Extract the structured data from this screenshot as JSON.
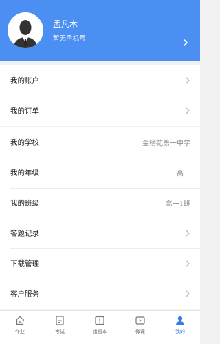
{
  "header": {
    "name": "孟凡木",
    "phone": "暂无手机号"
  },
  "sections": [
    {
      "rows": [
        {
          "label": "我的账户",
          "arrow": true
        },
        {
          "label": "我的订单",
          "arrow": true
        }
      ]
    },
    {
      "rows": [
        {
          "label": "我的学校",
          "value": "金榜苑第一中学"
        },
        {
          "label": "我的年级",
          "value": "高一"
        },
        {
          "label": "我的班级",
          "value": "高一1班"
        }
      ]
    },
    {
      "rows": [
        {
          "label": "答题记录",
          "arrow": true
        },
        {
          "label": "下载管理",
          "arrow": true
        },
        {
          "label": "客户服务",
          "arrow": true
        }
      ]
    }
  ],
  "tabbar": {
    "tabs": [
      {
        "label": "作业",
        "icon": "home-icon"
      },
      {
        "label": "考试",
        "icon": "exam-icon"
      },
      {
        "label": "错题本",
        "icon": "mistakes-icon"
      },
      {
        "label": "微课",
        "icon": "video-icon"
      },
      {
        "label": "我的",
        "icon": "profile-icon",
        "active": true
      }
    ]
  },
  "colors": {
    "header_bg": "#4b8ff2",
    "tab_active": "#3a7de0",
    "tab_inactive": "#666666"
  }
}
